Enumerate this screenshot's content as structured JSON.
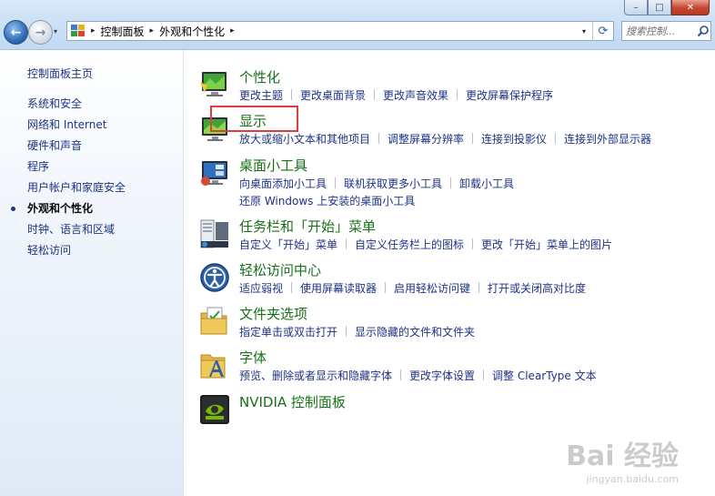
{
  "window": {
    "controls": {
      "minimize": "–",
      "maximize": "□",
      "close": "✕"
    }
  },
  "nav": {
    "back_glyph": "←",
    "forward_glyph": "→",
    "dropdown_glyph": "▾"
  },
  "address": {
    "crumbs": [
      "控制面板",
      "外观和个性化"
    ],
    "separator": "▸",
    "dropdown_glyph": "▾"
  },
  "refresh_glyph": "⟳",
  "search": {
    "placeholder": "搜索控制..."
  },
  "sidebar": {
    "home": "控制面板主页",
    "items": [
      {
        "label": "系统和安全",
        "active": false
      },
      {
        "label": "网络和 Internet",
        "active": false
      },
      {
        "label": "硬件和声音",
        "active": false
      },
      {
        "label": "程序",
        "active": false
      },
      {
        "label": "用户帐户和家庭安全",
        "active": false
      },
      {
        "label": "外观和个性化",
        "active": true
      },
      {
        "label": "时钟、语言和区域",
        "active": false
      },
      {
        "label": "轻松访问",
        "active": false
      }
    ]
  },
  "categories": [
    {
      "title": "个性化",
      "icon": "personalization-icon",
      "links": [
        [
          "更改主题",
          "更改桌面背景",
          "更改声音效果",
          "更改屏幕保护程序"
        ]
      ]
    },
    {
      "title": "显示",
      "icon": "display-icon",
      "links": [
        [
          "放大或缩小文本和其他项目",
          "调整屏幕分辨率",
          "连接到投影仪",
          "连接到外部显示器"
        ]
      ]
    },
    {
      "title": "桌面小工具",
      "icon": "desktop-gadgets-icon",
      "links": [
        [
          "向桌面添加小工具",
          "联机获取更多小工具",
          "卸载小工具"
        ],
        [
          "还原 Windows 上安装的桌面小工具"
        ]
      ]
    },
    {
      "title": "任务栏和「开始」菜单",
      "icon": "taskbar-icon",
      "links": [
        [
          "自定义「开始」菜单",
          "自定义任务栏上的图标",
          "更改「开始」菜单上的图片"
        ]
      ]
    },
    {
      "title": "轻松访问中心",
      "icon": "ease-of-access-icon",
      "links": [
        [
          "适应弱视",
          "使用屏幕读取器",
          "启用轻松访问键",
          "打开或关闭高对比度"
        ]
      ]
    },
    {
      "title": "文件夹选项",
      "icon": "folder-options-icon",
      "links": [
        [
          "指定单击或双击打开",
          "显示隐藏的文件和文件夹"
        ]
      ]
    },
    {
      "title": "字体",
      "icon": "fonts-icon",
      "links": [
        [
          "预览、删除或者显示和隐藏字体",
          "更改字体设置",
          "调整 ClearType 文本"
        ]
      ]
    },
    {
      "title": "NVIDIA 控制面板",
      "icon": "nvidia-icon",
      "links": []
    }
  ],
  "watermark": {
    "logo": "Bai 经验",
    "url": "jingyan.baidu.com"
  },
  "colors": {
    "category_title": "#187119",
    "link": "#1e3287",
    "highlight_box": "#e23b3b"
  }
}
